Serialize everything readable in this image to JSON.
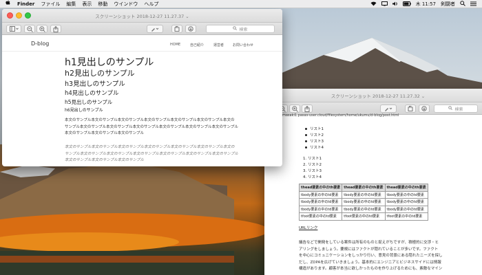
{
  "menubar": {
    "apple_icon": "apple-icon",
    "app": "Finder",
    "items": [
      "ファイル",
      "編集",
      "表示",
      "移動",
      "ウインドウ",
      "ヘルプ"
    ],
    "clock": "木 11:57",
    "user": "剣闘者"
  },
  "front_window": {
    "title": "スクリーンショット 2018-12-27 11.27.37 ⌄",
    "search_placeholder": "検索",
    "site": {
      "logo": "D-blog",
      "nav": [
        "HOME",
        "自己紹介",
        "運営者",
        "お問い合わせ"
      ]
    },
    "headings": [
      "h1見出しのサンプル",
      "h2見出しのサンプル",
      "h3見出しのサンプル",
      "h4見出しのサンプル",
      "h5見出しのサンプル",
      "h6見出しのサンプル"
    ],
    "paragraph": [
      "本文のサンプル本文のサンプル本文のサンプル本文のサンプル本文のサンプル本文のサンプル本文の",
      "サンプル本文のサンプル本文のサンプル本文のサンプル本文のサンプル本文のサンプル本文のサンプル",
      "本文のサンプル本文のサンプル本文のサンプル"
    ],
    "italic_paragraph": [
      "本文のサンプル本文のサンプル本文のサンプル本文のサンプル本文のサンプル本文のサンプル本文の",
      "サンプル本文のサンプル本文のサンプル本文のサンプル本文のサンプル本文のサンプル本文のサンプル",
      "本文のサンプル本文のサンプル本文のサンプル"
    ]
  },
  "back_window": {
    "title": "スクリーンショット 2018-12-27 11.27.32 ⌄",
    "search_placeholder": "検索",
    "url": "masaki1.pasas-user.cloud/filesystem/home/ukumu/d-blog/post.html",
    "bullet_list": [
      "リスト1",
      "リスト2",
      "リスト3",
      "リスト4"
    ],
    "numbered_list": [
      "リスト1",
      "リスト2",
      "リスト3",
      "リスト4"
    ],
    "table": {
      "head": [
        "thead要素の中のth要素",
        "thead要素の中のth要素",
        "thead要素の中のth要素"
      ],
      "body": [
        [
          "tbody要素の中のtd要素",
          "tbody要素の中のtd要素",
          "tbody要素の中のtd要素"
        ],
        [
          "tbody要素の中のtd要素",
          "tbody要素の中のtd要素",
          "tbody要素の中のtd要素"
        ],
        [
          "tbody要素の中のtd要素",
          "tbody要素の中のtd要素",
          "tbody要素の中のtd要素"
        ]
      ],
      "foot": [
        "tfoot要素の中のtd要素",
        "tfoot要素の中のtd要素",
        "tfoot要素の中のtd要素"
      ]
    },
    "link": "URLリンク",
    "body_text": [
      "議告などで開発をしている案件は所有のものと捉えがちですが、積極的に交渉・ヒ",
      "アリングをしましょう。要規にはファクトが隠れていることが多いです。ファクト",
      "を中心にコミュニケーションをしっかり行い、意見の背景にある隠れたニーズを探し",
      "だし、ZDPAを広げていきましょう。基本的にエンジニアとビジネスサイドには情報",
      "構造があります。顧客が本当に欲しかったものを作り上げるためにも、素敵なマイン"
    ]
  },
  "colors": {
    "menubar": "#eeeeee",
    "window": "#ffffff",
    "link": "#222222"
  }
}
